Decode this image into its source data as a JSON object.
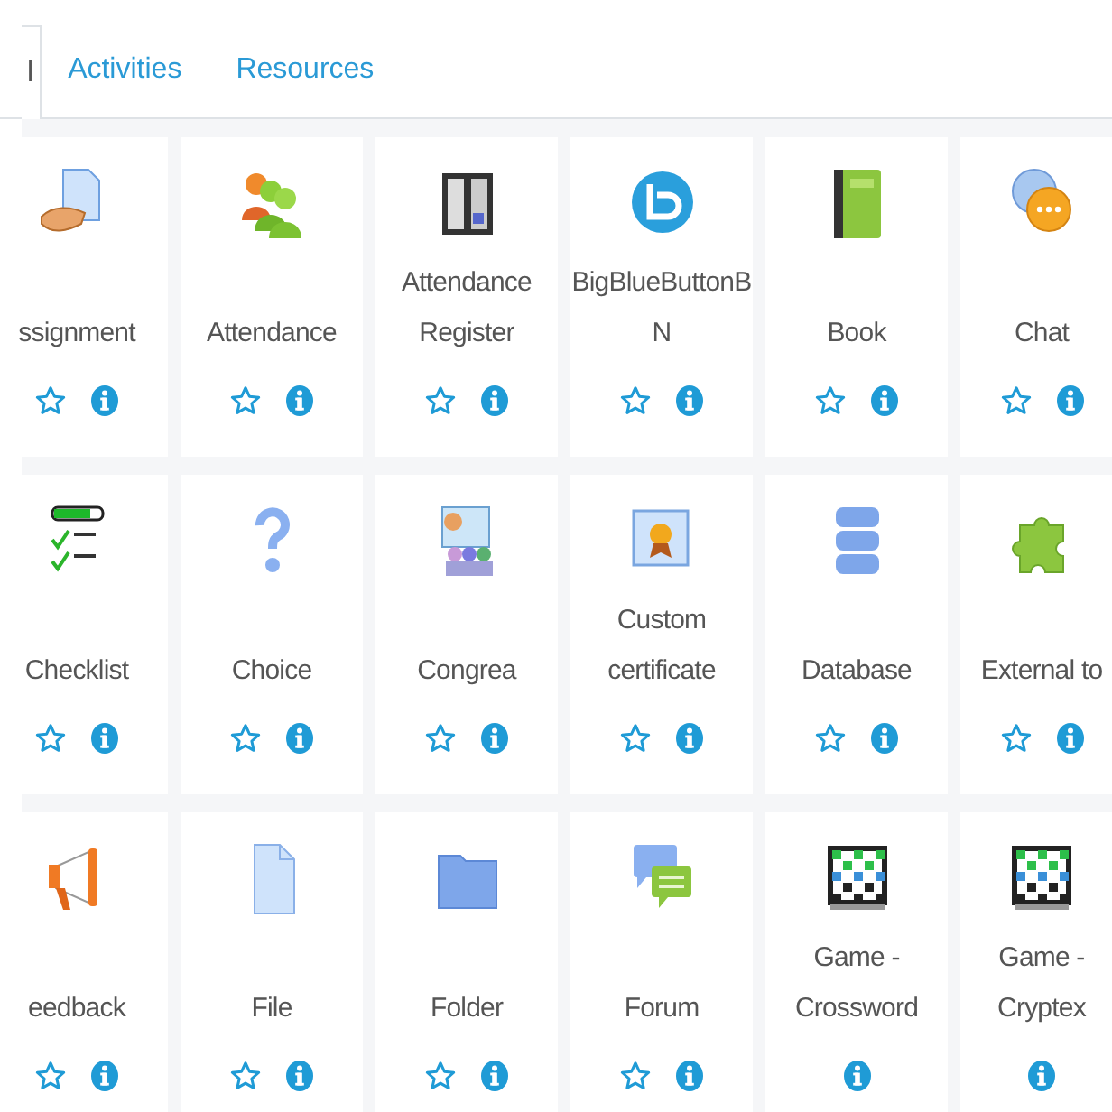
{
  "tabs": [
    {
      "label": "l",
      "selected": true
    },
    {
      "label": "Activities",
      "selected": false
    },
    {
      "label": "Resources",
      "selected": false
    }
  ],
  "items": [
    {
      "lines": [
        "ssignment"
      ],
      "starrable": true
    },
    {
      "lines": [
        "Attendance"
      ],
      "starrable": true
    },
    {
      "lines": [
        "Attendance",
        "Register"
      ],
      "starrable": true
    },
    {
      "lines": [
        "BigBlueButtonB",
        "N"
      ],
      "starrable": true
    },
    {
      "lines": [
        "Book"
      ],
      "starrable": true
    },
    {
      "lines": [
        "Chat"
      ],
      "starrable": true
    },
    {
      "lines": [
        "Checklist"
      ],
      "starrable": true
    },
    {
      "lines": [
        "Choice"
      ],
      "starrable": true
    },
    {
      "lines": [
        "Congrea"
      ],
      "starrable": true
    },
    {
      "lines": [
        "Custom",
        "certificate"
      ],
      "starrable": true
    },
    {
      "lines": [
        "Database"
      ],
      "starrable": true
    },
    {
      "lines": [
        "External to"
      ],
      "starrable": true
    },
    {
      "lines": [
        "eedback"
      ],
      "starrable": true
    },
    {
      "lines": [
        "File"
      ],
      "starrable": true
    },
    {
      "lines": [
        "Folder"
      ],
      "starrable": true
    },
    {
      "lines": [
        "Forum"
      ],
      "starrable": true
    },
    {
      "lines": [
        "Game -",
        "Crossword"
      ],
      "starrable": false
    },
    {
      "lines": [
        "Game -",
        "Cryptex"
      ],
      "starrable": false
    }
  ]
}
